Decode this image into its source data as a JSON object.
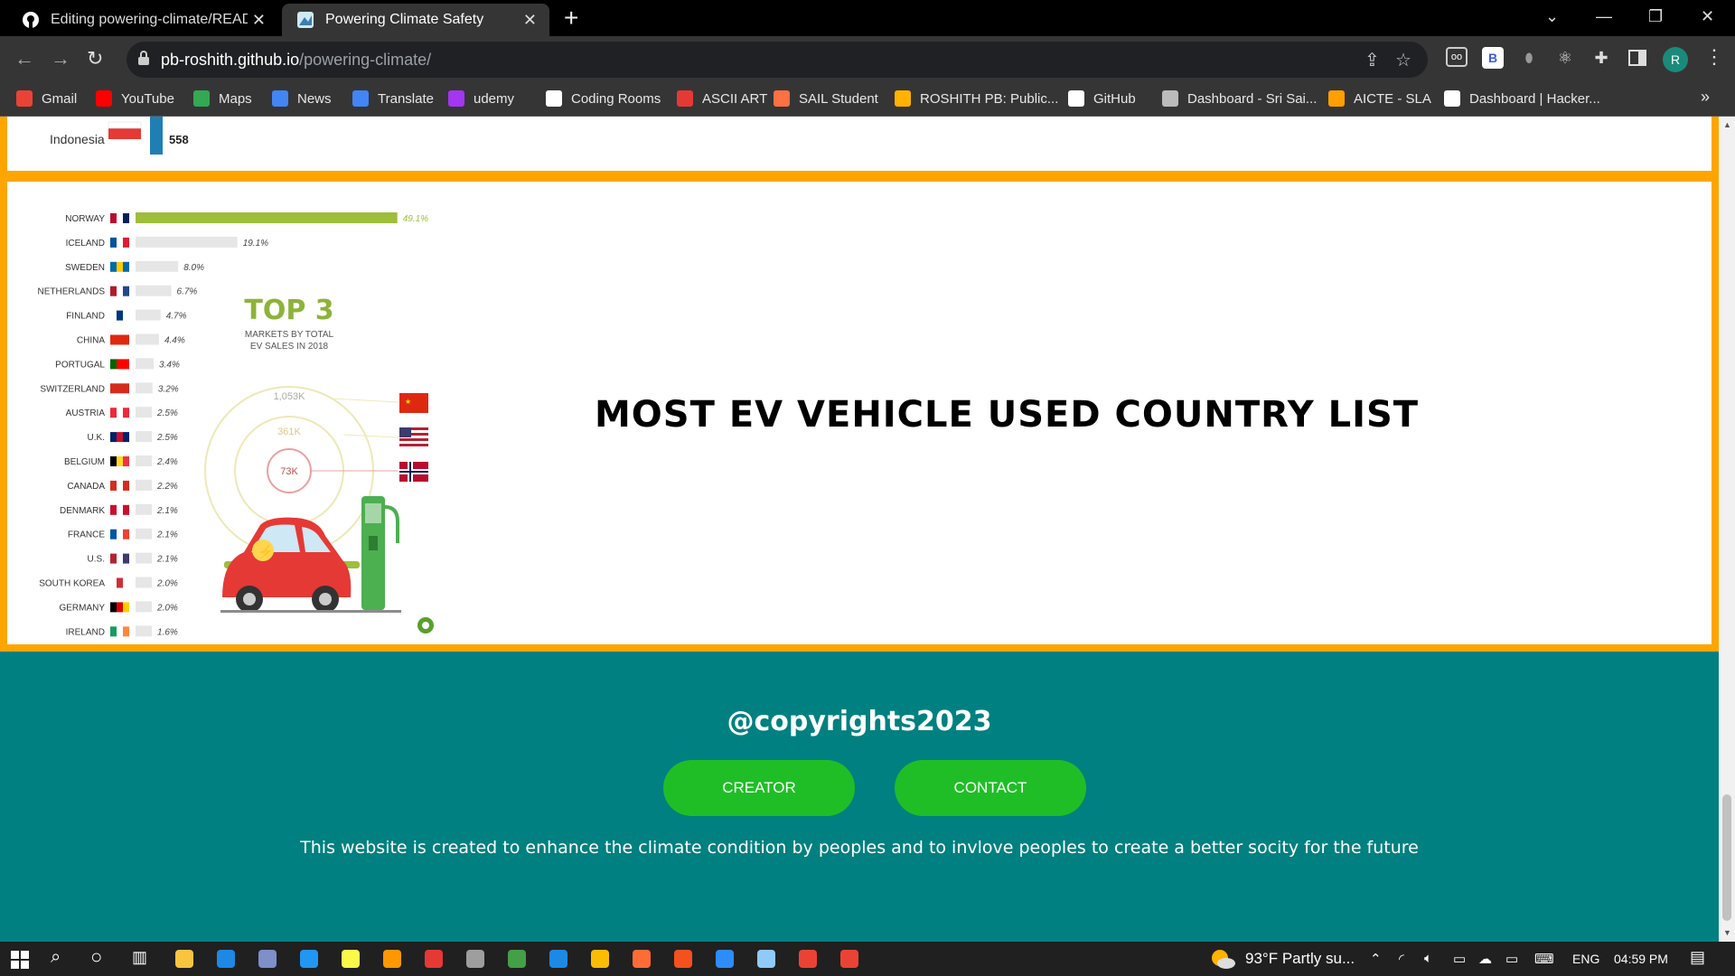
{
  "tabs": [
    {
      "title": "Editing powering-climate/README",
      "close": "✕"
    },
    {
      "title": "Powering Climate Safety",
      "close": "✕"
    }
  ],
  "new_tab": "+",
  "window_controls": {
    "chevron": "⌄",
    "minimize": "—",
    "restore": "❐",
    "close": "✕"
  },
  "address": {
    "host": "pb-roshith.github.io",
    "path": "/powering-climate/"
  },
  "profile_initial": "R",
  "ext_b": "B",
  "bookmarks": [
    {
      "label": "Gmail",
      "color": "#ea4335"
    },
    {
      "label": "YouTube",
      "color": "#ff0000"
    },
    {
      "label": "Maps",
      "color": "#34a853"
    },
    {
      "label": "News",
      "color": "#4285f4"
    },
    {
      "label": "Translate",
      "color": "#4285f4"
    },
    {
      "label": "udemy",
      "color": "#a435f0"
    },
    {
      "label": "Coding Rooms",
      "color": "#ffffff"
    },
    {
      "label": "ASCII ART",
      "color": "#e53935"
    },
    {
      "label": "SAIL Student",
      "color": "#ff7043"
    },
    {
      "label": "ROSHITH PB: Public...",
      "color": "#ffb300"
    },
    {
      "label": "GitHub",
      "color": "#ffffff"
    },
    {
      "label": "Dashboard - Sri Sai...",
      "color": "#bbbbbb"
    },
    {
      "label": "AICTE - SLA",
      "color": "#ffa000"
    },
    {
      "label": "Dashboard | Hacker...",
      "color": "#ffffff"
    }
  ],
  "bookmarks_overflow": "»",
  "top_chart": {
    "country": "Indonesia",
    "value": "558"
  },
  "ev_chart": {
    "top3_title": "TOP 3",
    "top3_subtitle_1": "MARKETS BY TOTAL",
    "top3_subtitle_2": "EV SALES IN 2018",
    "circles": [
      "1,053K",
      "361K",
      "73K"
    ]
  },
  "chart_data": {
    "type": "bar",
    "categories": [
      "NORWAY",
      "ICELAND",
      "SWEDEN",
      "NETHERLANDS",
      "FINLAND",
      "CHINA",
      "PORTUGAL",
      "SWITZERLAND",
      "AUSTRIA",
      "U.K.",
      "BELGIUM",
      "CANADA",
      "DENMARK",
      "FRANCE",
      "U.S.",
      "SOUTH KOREA",
      "GERMANY",
      "IRELAND"
    ],
    "values": [
      49.1,
      19.1,
      8.0,
      6.7,
      4.7,
      4.4,
      3.4,
      3.2,
      2.5,
      2.5,
      2.4,
      2.2,
      2.1,
      2.1,
      2.1,
      2.0,
      2.0,
      1.6
    ],
    "labels": [
      "49.1%",
      "19.1%",
      "8.0%",
      "6.7%",
      "4.7%",
      "4.4%",
      "3.4%",
      "3.2%",
      "2.5%",
      "2.5%",
      "2.4%",
      "2.2%",
      "2.1%",
      "2.1%",
      "2.1%",
      "2.0%",
      "2.0%",
      "1.6%"
    ],
    "highlight_color": "#9ebe3c",
    "bar_color": "#e6e6e6",
    "xlim": [
      0,
      50
    ]
  },
  "ev_heading": "MOST EV VEHICLE USED COUNTRY LIST",
  "footer": {
    "copyright": "@copyrights2023",
    "creator": "CREATOR",
    "contact": "CONTACT",
    "text": "This website is created to enhance the climate condition by peoples and to invlove peoples to create a better socity for the future"
  },
  "taskbar": {
    "weather": "93°F  Partly su...",
    "lang": "ENG",
    "time": "04:59 PM"
  },
  "colors": {
    "accent": "#ffa500",
    "footer": "#008080",
    "button": "#1fbe26"
  }
}
